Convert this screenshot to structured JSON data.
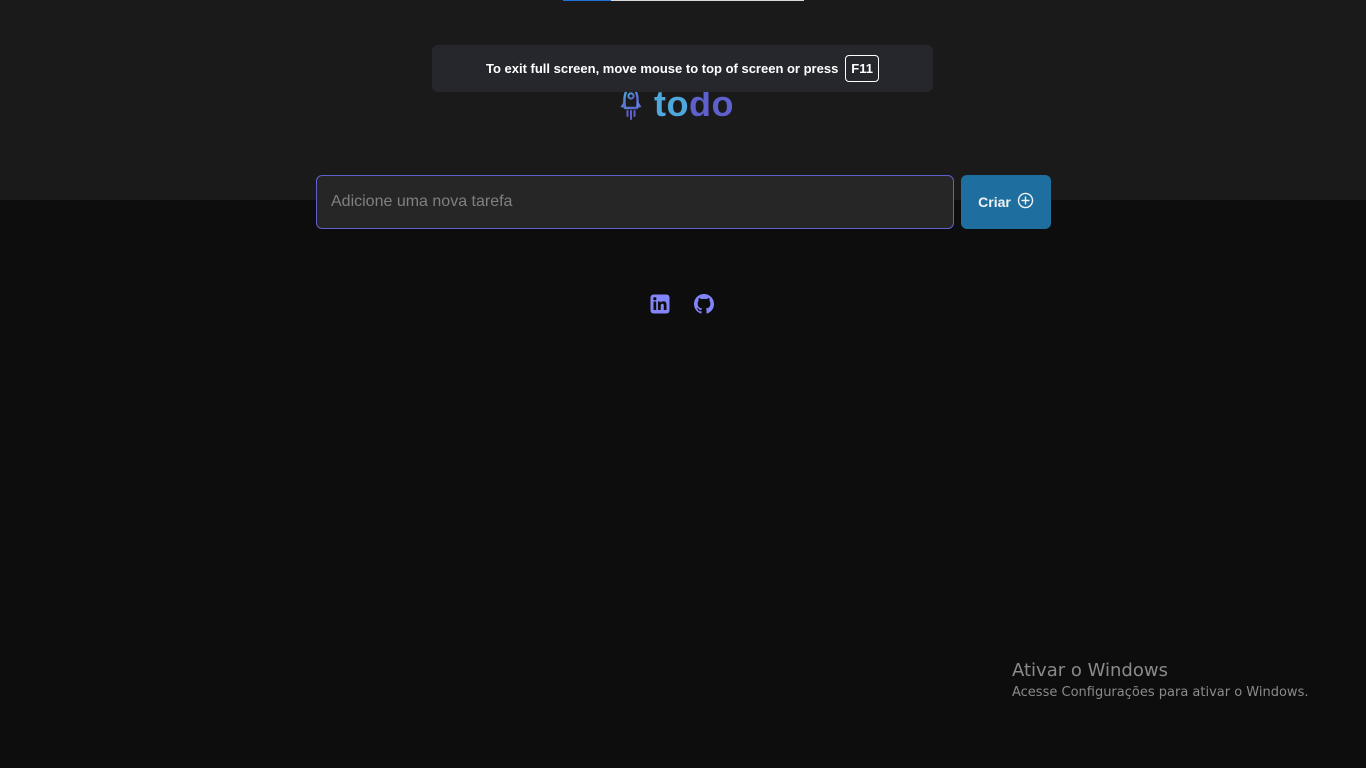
{
  "browser": {
    "fullscreen_notice": "To exit full screen, move mouse to top of screen or press",
    "fullscreen_key": "F11",
    "load_progress": 0.2
  },
  "header": {
    "logo_part1": "to",
    "logo_part2": "do",
    "logo_icon": "rocket-icon",
    "colors": {
      "logo_blue": "#4ea8de",
      "logo_purple": "#5e60ce",
      "header_bg": "#1a1a1a"
    }
  },
  "task_form": {
    "input_value": "",
    "input_placeholder": "Adicione uma nova tarefa",
    "create_label": "Criar",
    "create_icon": "plus-circle-icon",
    "colors": {
      "button_bg": "#1e6f9f",
      "input_border": "#5e60ce"
    }
  },
  "footer": {
    "social_links": [
      {
        "icon": "linkedin-icon"
      },
      {
        "icon": "github-icon"
      }
    ],
    "icon_color": "#8284fa"
  },
  "os_watermark": {
    "title": "Ativar o Windows",
    "subtitle": "Acesse Configurações para ativar o Windows."
  }
}
